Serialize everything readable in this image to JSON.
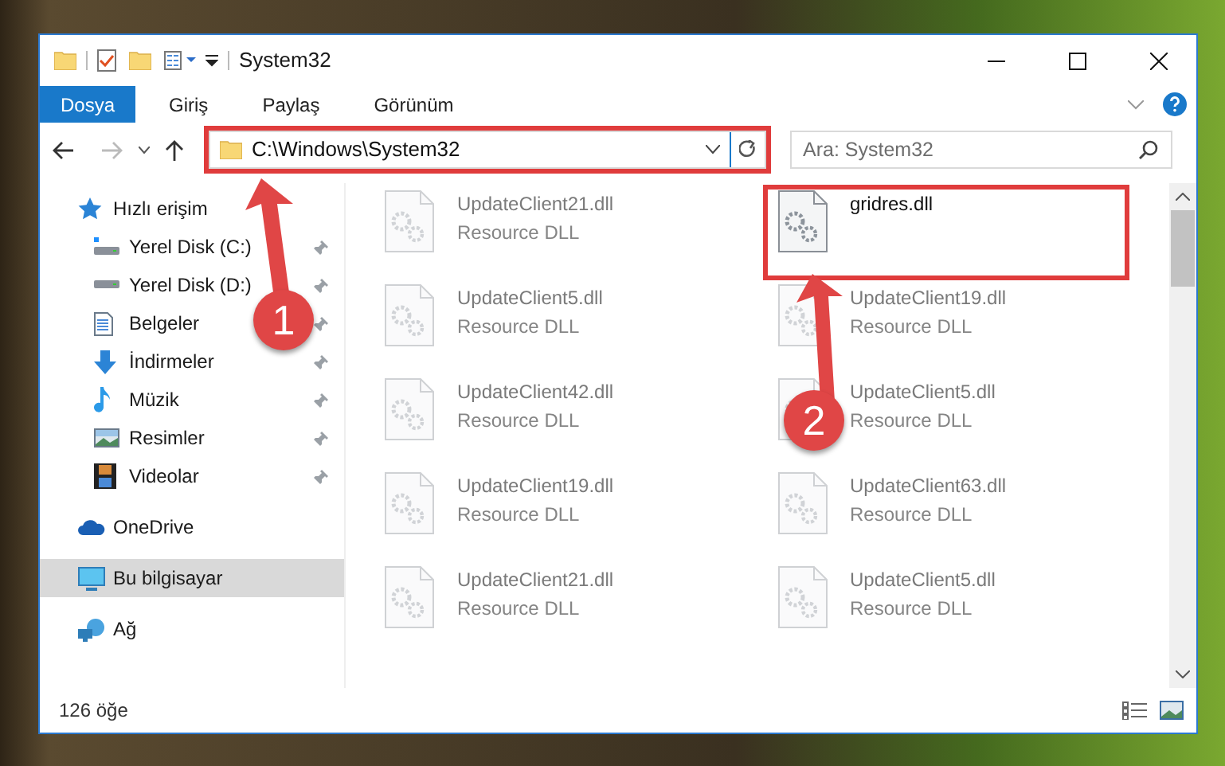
{
  "window": {
    "title": "System32"
  },
  "ribbon_tabs": [
    {
      "label": "Dosya",
      "selected": true
    },
    {
      "label": "Giriş",
      "selected": false
    },
    {
      "label": "Paylaş",
      "selected": false
    },
    {
      "label": "Görünüm",
      "selected": false
    }
  ],
  "address_bar": {
    "path": "C:\\Windows\\System32"
  },
  "search": {
    "placeholder": "Ara: System32"
  },
  "sidebar": {
    "items": [
      {
        "label": "Hızlı erişim",
        "selected": false,
        "children": [
          {
            "label": "Yerel Disk (C:)",
            "pinned": true,
            "selected": false
          },
          {
            "label": "Yerel Disk (D:)",
            "pinned": true,
            "selected": false
          },
          {
            "label": "Belgeler",
            "pinned": true,
            "selected": false
          },
          {
            "label": "İndirmeler",
            "pinned": true,
            "selected": false
          },
          {
            "label": "Müzik",
            "pinned": true,
            "selected": false
          },
          {
            "label": "Resimler",
            "pinned": true,
            "selected": false
          },
          {
            "label": "Videolar",
            "pinned": true,
            "selected": false
          }
        ]
      },
      {
        "label": "OneDrive",
        "selected": false
      },
      {
        "label": "Bu bilgisayar",
        "selected": true
      },
      {
        "label": "Ağ",
        "selected": false
      }
    ]
  },
  "files": [
    {
      "name": "UpdateClient21.dll",
      "type": "Resource DLL",
      "blurred": true
    },
    {
      "name": "gridres.dll",
      "blurred": false
    },
    {
      "name": "UpdateClient5.dll",
      "type": "Resource DLL",
      "blurred": true
    },
    {
      "name": "UpdateClient19.dll",
      "type": "Resource DLL",
      "blurred": true
    },
    {
      "name": "UpdateClient42.dll",
      "type": "Resource DLL",
      "blurred": true
    },
    {
      "name": "UpdateClient5.dll",
      "type": "Resource DLL",
      "blurred": true
    },
    {
      "name": "UpdateClient19.dll",
      "type": "Resource DLL",
      "blurred": true
    },
    {
      "name": "UpdateClient63.dll",
      "type": "Resource DLL",
      "blurred": true
    },
    {
      "name": "UpdateClient21.dll",
      "type": "Resource DLL",
      "blurred": true
    },
    {
      "name": "UpdateClient5.dll",
      "type": "Resource DLL",
      "blurred": true
    }
  ],
  "status_bar": {
    "item_count": "126 öğe"
  },
  "annotations": [
    {
      "number": "1"
    },
    {
      "number": "2"
    }
  ]
}
